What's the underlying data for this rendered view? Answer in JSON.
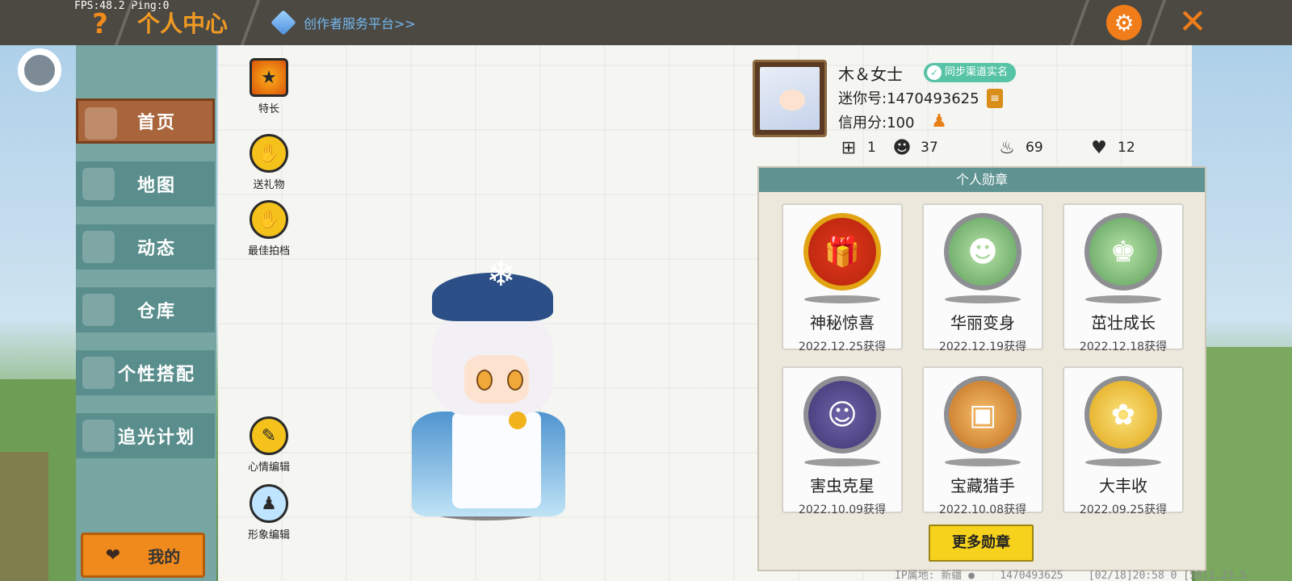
{
  "debug": {
    "fps": "FPS:48.2",
    "ping": "Ping:0"
  },
  "header": {
    "title": "个人中心",
    "creator_link": "创作者服务平台>>",
    "help_icon": "question-icon",
    "settings_icon": "gear-icon",
    "close_icon": "close-icon"
  },
  "sidebar": {
    "items": [
      {
        "label": "首页",
        "icon": "home-icon",
        "active": true
      },
      {
        "label": "地图",
        "icon": "map-icon",
        "active": false
      },
      {
        "label": "动态",
        "icon": "bell-icon",
        "active": false
      },
      {
        "label": "仓库",
        "icon": "warehouse-icon",
        "active": false
      },
      {
        "label": "个性搭配",
        "icon": "outfit-icon",
        "active": false
      },
      {
        "label": "追光计划",
        "icon": "plan-icon",
        "active": false
      }
    ],
    "my_button": "我的"
  },
  "actions": [
    {
      "label": "特长",
      "icon": "talent-icon"
    },
    {
      "label": "送礼物",
      "icon": "gift-icon"
    },
    {
      "label": "最佳拍档",
      "icon": "handshake-icon"
    },
    {
      "label": "心情编辑",
      "icon": "edit-icon"
    },
    {
      "label": "形象编辑",
      "icon": "outfit-edit-icon"
    }
  ],
  "profile": {
    "name": "木＆女士",
    "verify_badge": "同步渠道实名",
    "mini_id": "迷你号:1470493625",
    "credit": "信用分:100",
    "stats": [
      {
        "icon": "add-friend-icon",
        "value": "1"
      },
      {
        "icon": "cheer-icon",
        "value": "37"
      },
      {
        "icon": "fire-icon",
        "value": "69"
      },
      {
        "icon": "heart-icon",
        "value": "12"
      }
    ]
  },
  "medals": {
    "header": "个人勋章",
    "items": [
      {
        "name": "神秘惊喜",
        "date": "2022.12.25获得",
        "icon": "gift-box-medal-icon"
      },
      {
        "name": "华丽变身",
        "date": "2022.12.19获得",
        "icon": "dinosaur-medal-icon"
      },
      {
        "name": "茁壮成长",
        "date": "2022.12.18获得",
        "icon": "frog-king-medal-icon"
      },
      {
        "name": "害虫克星",
        "date": "2022.10.09获得",
        "icon": "worm-medal-icon"
      },
      {
        "name": "宝藏猎手",
        "date": "2022.10.08获得",
        "icon": "treasure-medal-icon"
      },
      {
        "name": "大丰收",
        "date": "2022.09.25获得",
        "icon": "harvest-medal-icon"
      }
    ],
    "more_button": "更多勋章"
  },
  "footer": {
    "ip_location": "IP属地: 新疆",
    "account": "1470493625",
    "timestamp": "[02/18]20:58 0  [58]1.23.5"
  }
}
